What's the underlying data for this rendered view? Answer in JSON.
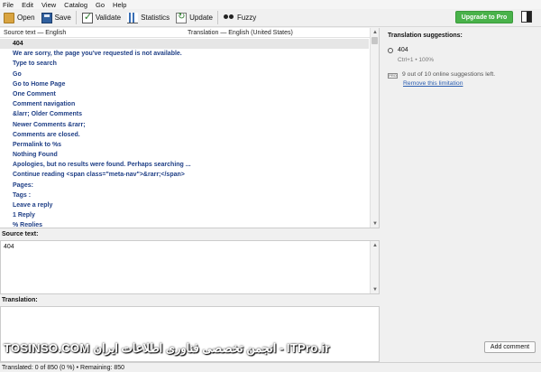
{
  "menu": [
    "File",
    "Edit",
    "View",
    "Catalog",
    "Go",
    "Help"
  ],
  "toolbar": {
    "open_label": "Open",
    "save_label": "Save",
    "validate_label": "Validate",
    "statistics_label": "Statistics",
    "update_label": "Update",
    "fuzzy_label": "Fuzzy",
    "upgrade_label": "Upgrade to Pro"
  },
  "list": {
    "source_header": "Source text — English",
    "translation_header": "Translation — English (United States)",
    "rows": [
      "404",
      "We are sorry, the page you've requested is not available.",
      "Type to search",
      "Go",
      "Go to Home Page",
      "One Comment",
      "Comment navigation",
      "&larr; Older Comments",
      "Newer Comments &rarr;",
      "Comments are closed.",
      "Permalink to %s",
      "Nothing Found",
      "Apologies, but no results were found. Perhaps searching ...",
      "Continue reading <span class=\"meta-nav\">&rarr;</span>",
      "Pages:",
      "Tags :",
      "Leave a reply",
      "1 Reply",
      "% Replies"
    ],
    "selected_index": 0
  },
  "editor": {
    "source_label": "Source text:",
    "source_value": "404",
    "translation_label": "Translation:",
    "translation_value": ""
  },
  "suggestions": {
    "title": "Translation suggestions:",
    "item_text": "404",
    "item_meta": "Ctrl+1 • 100%",
    "pro_badge": "PRO",
    "pro_text": "9 out of 10 online suggestions left.",
    "pro_link": "Remove this limitation"
  },
  "add_comment_label": "Add comment",
  "status": "Translated: 0 of 850 (0 %)  •  Remaining: 850",
  "watermark": "TOSINSO.COM انجمن تخصصی فناوری اطلاعات ایران - ITPro.ir",
  "colors": {
    "upgrade": "#49b24a",
    "source_rows": "#1f3f86",
    "link": "#2a5db0"
  }
}
